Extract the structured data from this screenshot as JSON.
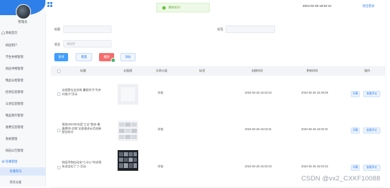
{
  "user": {
    "name": "管理员"
  },
  "sidebar": {
    "items": [
      {
        "label": "系统首页"
      },
      {
        "label": "校园用户"
      },
      {
        "label": "学生失物管理"
      },
      {
        "label": "校园寻物管理"
      },
      {
        "label": "物品分类管理"
      },
      {
        "label": "招领信息管理"
      },
      {
        "label": "认领信息管理"
      },
      {
        "label": "物品寄存管理"
      },
      {
        "label": "收费信息管理"
      },
      {
        "label": "系统管理"
      },
      {
        "label": "校园公告管理"
      },
      {
        "label": "轮播管理"
      },
      {
        "label": "轮播资讯",
        "selected": true
      },
      {
        "label": "资讯分类"
      }
    ]
  },
  "header": {
    "title_stub": "系统",
    "datetime": "2024-02-25 15:52:12",
    "logout": "退出登录"
  },
  "toast": {
    "text": "删除成功！",
    "color": "#67c23a"
  },
  "search": {
    "title_label": "标题",
    "title_placeholder": "",
    "tag_label": "标签",
    "tag_placeholder": "",
    "status_label": "状态",
    "status_placeholder": "请选择"
  },
  "buttons": {
    "search": "查询",
    "reset": "重置",
    "delete": "删除",
    "add": "添加"
  },
  "table": {
    "headers": [
      "",
      "标题",
      "封面图",
      "文章分类",
      "标签",
      "创建时间",
      "更新时间",
      "操作"
    ],
    "rows": [
      {
        "title": "这就是社会实践 暑假学子\"为乡村振兴\"活动",
        "category": "学校",
        "tag": "",
        "created": "2024-02-25 15:02:34",
        "updated": "2024-02-25 15:49:09",
        "actions": [
          "详情",
          "查看评论"
        ]
      },
      {
        "title": "我校2023年年度\"三全\"育体-最美教师-实践\"全面推进示范创新提名研讨",
        "category": "学校",
        "tag": "",
        "created": "2024-02-25 15:02:31",
        "updated": "2024-02-25 15:02:31",
        "actions": [
          "详情",
          "查看评论"
        ]
      },
      {
        "title": "校园寻物自动化\"小诊心\"你说我有说话也了了-活动",
        "category": "学校",
        "tag": "",
        "created": "2024-02-25 15:02:23",
        "updated": "2024-02-25 15:02:23",
        "actions": [
          "详情",
          "查看评论"
        ]
      }
    ]
  },
  "watermark": "CSDN @vx2_CXKF10088"
}
